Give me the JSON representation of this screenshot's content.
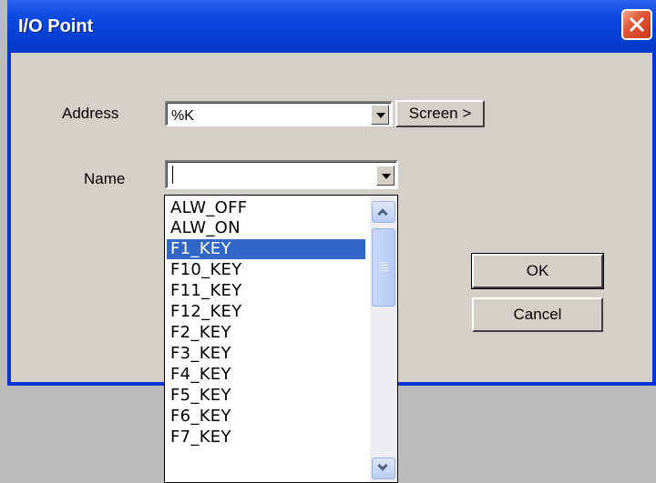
{
  "dialog": {
    "title": "I/O Point",
    "address_label": "Address",
    "address_value": "%K",
    "screen_button": "Screen >",
    "name_label": "Name",
    "name_value": "",
    "ok_button": "OK",
    "cancel_button": "Cancel"
  },
  "name_dropdown": {
    "items": [
      "ALW_OFF",
      "ALW_ON",
      "F1_KEY",
      "F10_KEY",
      "F11_KEY",
      "F12_KEY",
      "F2_KEY",
      "F3_KEY",
      "F4_KEY",
      "F5_KEY",
      "F6_KEY",
      "F7_KEY"
    ],
    "selected": "F1_KEY"
  },
  "colors": {
    "titlebar": "#0a48e0",
    "selection": "#3168c8",
    "dialog_face": "#d4d0c8",
    "close_button": "#e0583a"
  },
  "icons": {
    "close": "close-icon",
    "dropdown": "chevron-down-icon",
    "scroll_up": "chevron-up-icon",
    "scroll_down": "chevron-down-icon"
  }
}
